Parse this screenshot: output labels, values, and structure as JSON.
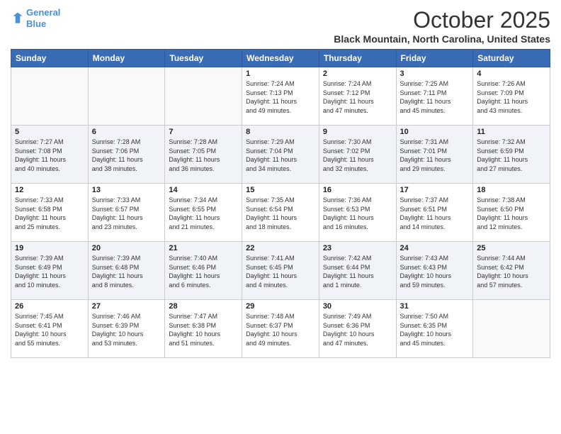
{
  "logo": {
    "line1": "General",
    "line2": "Blue"
  },
  "title": "October 2025",
  "subtitle": "Black Mountain, North Carolina, United States",
  "days_header": [
    "Sunday",
    "Monday",
    "Tuesday",
    "Wednesday",
    "Thursday",
    "Friday",
    "Saturday"
  ],
  "weeks": [
    [
      {
        "day": "",
        "info": ""
      },
      {
        "day": "",
        "info": ""
      },
      {
        "day": "",
        "info": ""
      },
      {
        "day": "1",
        "info": "Sunrise: 7:24 AM\nSunset: 7:13 PM\nDaylight: 11 hours\nand 49 minutes."
      },
      {
        "day": "2",
        "info": "Sunrise: 7:24 AM\nSunset: 7:12 PM\nDaylight: 11 hours\nand 47 minutes."
      },
      {
        "day": "3",
        "info": "Sunrise: 7:25 AM\nSunset: 7:11 PM\nDaylight: 11 hours\nand 45 minutes."
      },
      {
        "day": "4",
        "info": "Sunrise: 7:26 AM\nSunset: 7:09 PM\nDaylight: 11 hours\nand 43 minutes."
      }
    ],
    [
      {
        "day": "5",
        "info": "Sunrise: 7:27 AM\nSunset: 7:08 PM\nDaylight: 11 hours\nand 40 minutes."
      },
      {
        "day": "6",
        "info": "Sunrise: 7:28 AM\nSunset: 7:06 PM\nDaylight: 11 hours\nand 38 minutes."
      },
      {
        "day": "7",
        "info": "Sunrise: 7:28 AM\nSunset: 7:05 PM\nDaylight: 11 hours\nand 36 minutes."
      },
      {
        "day": "8",
        "info": "Sunrise: 7:29 AM\nSunset: 7:04 PM\nDaylight: 11 hours\nand 34 minutes."
      },
      {
        "day": "9",
        "info": "Sunrise: 7:30 AM\nSunset: 7:02 PM\nDaylight: 11 hours\nand 32 minutes."
      },
      {
        "day": "10",
        "info": "Sunrise: 7:31 AM\nSunset: 7:01 PM\nDaylight: 11 hours\nand 29 minutes."
      },
      {
        "day": "11",
        "info": "Sunrise: 7:32 AM\nSunset: 6:59 PM\nDaylight: 11 hours\nand 27 minutes."
      }
    ],
    [
      {
        "day": "12",
        "info": "Sunrise: 7:33 AM\nSunset: 6:58 PM\nDaylight: 11 hours\nand 25 minutes."
      },
      {
        "day": "13",
        "info": "Sunrise: 7:33 AM\nSunset: 6:57 PM\nDaylight: 11 hours\nand 23 minutes."
      },
      {
        "day": "14",
        "info": "Sunrise: 7:34 AM\nSunset: 6:55 PM\nDaylight: 11 hours\nand 21 minutes."
      },
      {
        "day": "15",
        "info": "Sunrise: 7:35 AM\nSunset: 6:54 PM\nDaylight: 11 hours\nand 18 minutes."
      },
      {
        "day": "16",
        "info": "Sunrise: 7:36 AM\nSunset: 6:53 PM\nDaylight: 11 hours\nand 16 minutes."
      },
      {
        "day": "17",
        "info": "Sunrise: 7:37 AM\nSunset: 6:51 PM\nDaylight: 11 hours\nand 14 minutes."
      },
      {
        "day": "18",
        "info": "Sunrise: 7:38 AM\nSunset: 6:50 PM\nDaylight: 11 hours\nand 12 minutes."
      }
    ],
    [
      {
        "day": "19",
        "info": "Sunrise: 7:39 AM\nSunset: 6:49 PM\nDaylight: 11 hours\nand 10 minutes."
      },
      {
        "day": "20",
        "info": "Sunrise: 7:39 AM\nSunset: 6:48 PM\nDaylight: 11 hours\nand 8 minutes."
      },
      {
        "day": "21",
        "info": "Sunrise: 7:40 AM\nSunset: 6:46 PM\nDaylight: 11 hours\nand 6 minutes."
      },
      {
        "day": "22",
        "info": "Sunrise: 7:41 AM\nSunset: 6:45 PM\nDaylight: 11 hours\nand 4 minutes."
      },
      {
        "day": "23",
        "info": "Sunrise: 7:42 AM\nSunset: 6:44 PM\nDaylight: 11 hours\nand 1 minute."
      },
      {
        "day": "24",
        "info": "Sunrise: 7:43 AM\nSunset: 6:43 PM\nDaylight: 10 hours\nand 59 minutes."
      },
      {
        "day": "25",
        "info": "Sunrise: 7:44 AM\nSunset: 6:42 PM\nDaylight: 10 hours\nand 57 minutes."
      }
    ],
    [
      {
        "day": "26",
        "info": "Sunrise: 7:45 AM\nSunset: 6:41 PM\nDaylight: 10 hours\nand 55 minutes."
      },
      {
        "day": "27",
        "info": "Sunrise: 7:46 AM\nSunset: 6:39 PM\nDaylight: 10 hours\nand 53 minutes."
      },
      {
        "day": "28",
        "info": "Sunrise: 7:47 AM\nSunset: 6:38 PM\nDaylight: 10 hours\nand 51 minutes."
      },
      {
        "day": "29",
        "info": "Sunrise: 7:48 AM\nSunset: 6:37 PM\nDaylight: 10 hours\nand 49 minutes."
      },
      {
        "day": "30",
        "info": "Sunrise: 7:49 AM\nSunset: 6:36 PM\nDaylight: 10 hours\nand 47 minutes."
      },
      {
        "day": "31",
        "info": "Sunrise: 7:50 AM\nSunset: 6:35 PM\nDaylight: 10 hours\nand 45 minutes."
      },
      {
        "day": "",
        "info": ""
      }
    ]
  ]
}
